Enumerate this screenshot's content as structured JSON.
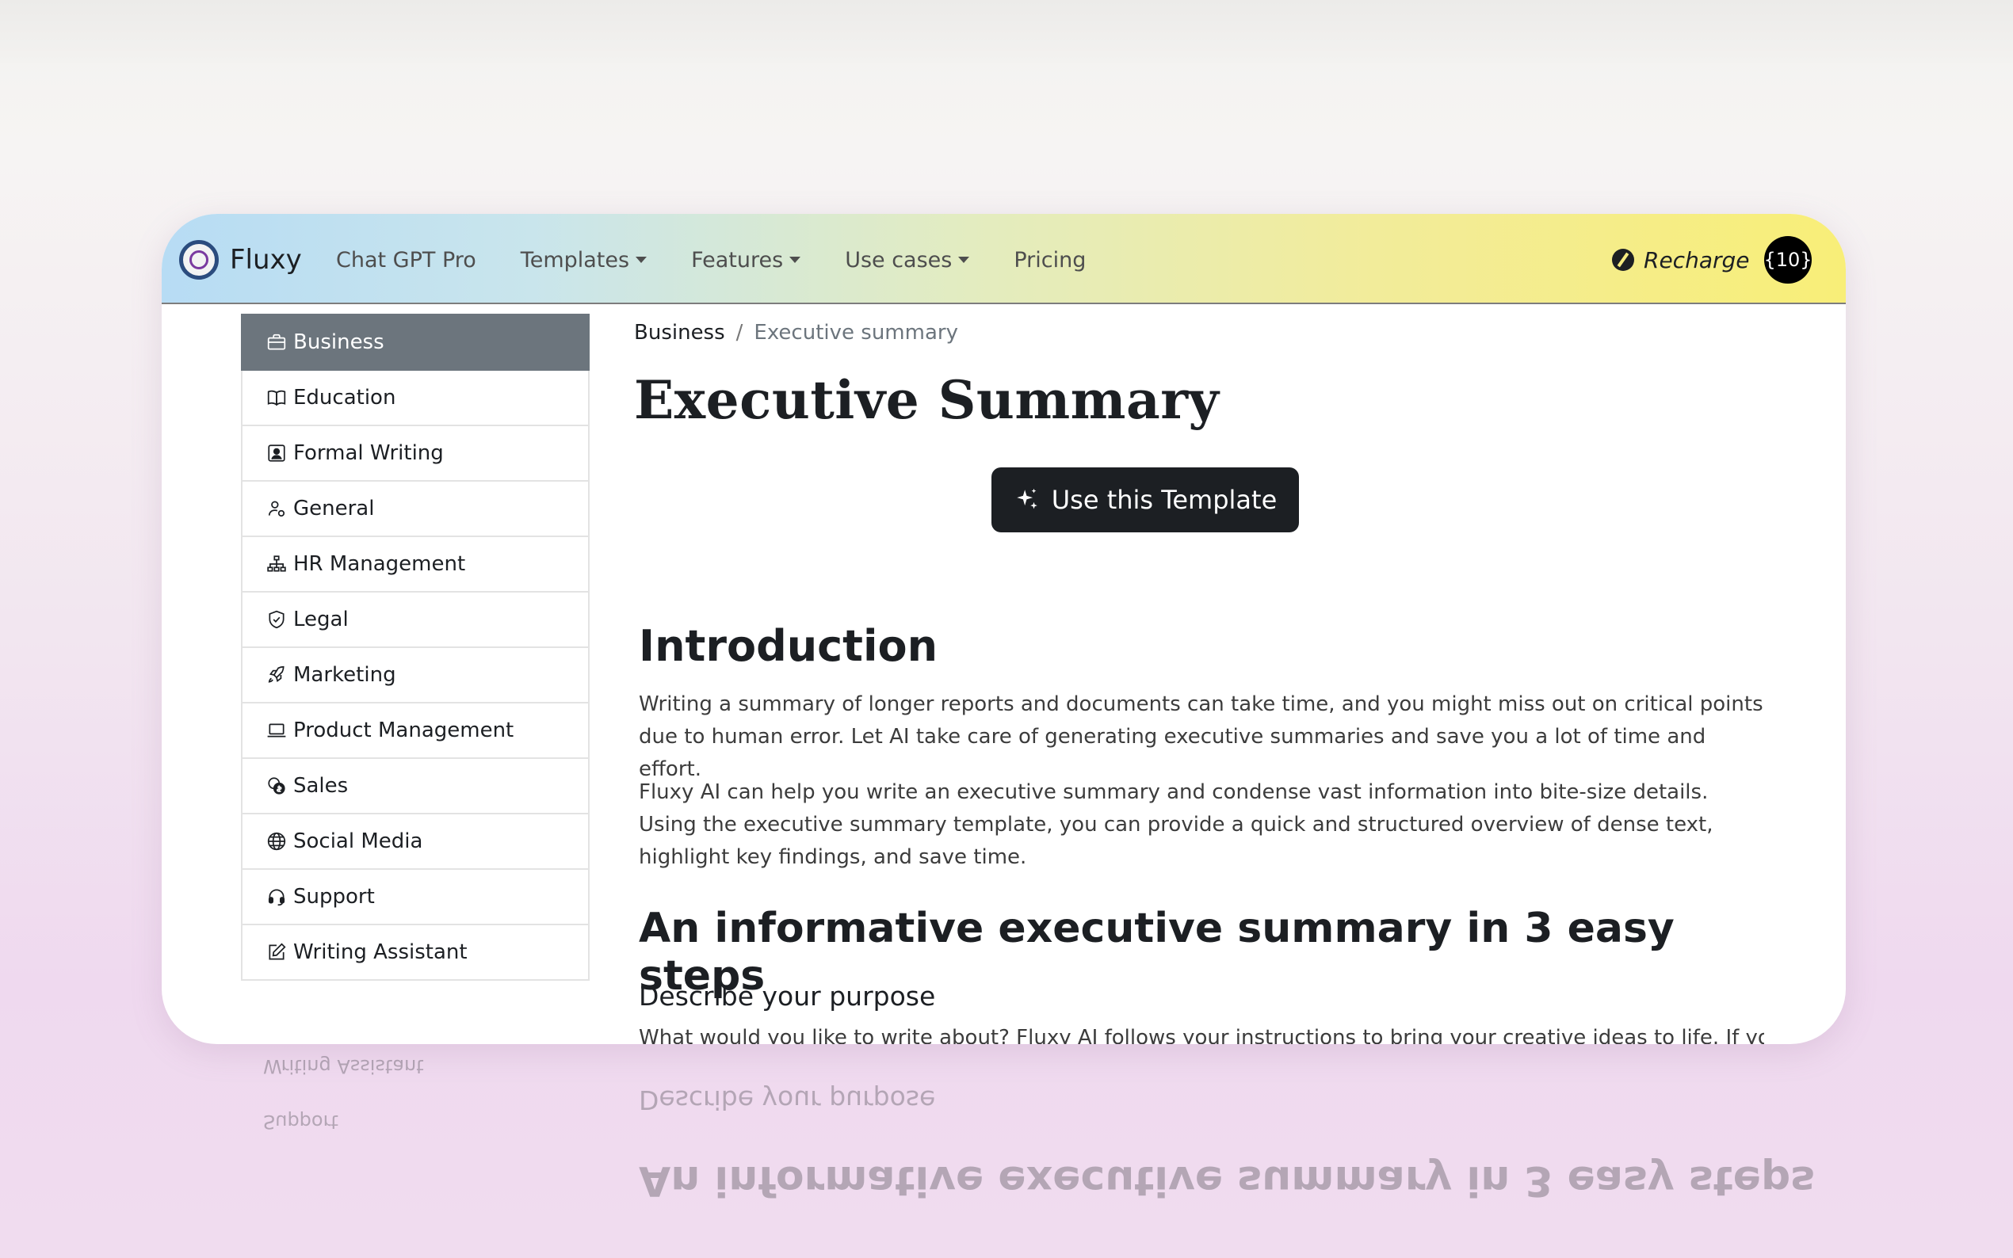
{
  "brand": {
    "name": "Fluxy"
  },
  "nav": {
    "links": [
      {
        "label": "Chat GPT Pro",
        "dropdown": false
      },
      {
        "label": "Templates",
        "dropdown": true
      },
      {
        "label": "Features",
        "dropdown": true
      },
      {
        "label": "Use cases",
        "dropdown": true
      },
      {
        "label": "Pricing",
        "dropdown": false
      }
    ],
    "recharge_label": "Recharge",
    "credits_label": "{10}"
  },
  "sidebar": {
    "items": [
      {
        "label": "Business",
        "icon": "briefcase-icon",
        "active": true
      },
      {
        "label": "Education",
        "icon": "book-icon",
        "active": false
      },
      {
        "label": "Formal Writing",
        "icon": "person-badge-icon",
        "active": false
      },
      {
        "label": "General",
        "icon": "person-gear-icon",
        "active": false
      },
      {
        "label": "HR Management",
        "icon": "org-chart-icon",
        "active": false
      },
      {
        "label": "Legal",
        "icon": "shield-check-icon",
        "active": false
      },
      {
        "label": "Marketing",
        "icon": "rocket-icon",
        "active": false
      },
      {
        "label": "Product Management",
        "icon": "laptop-icon",
        "active": false
      },
      {
        "label": "Sales",
        "icon": "coins-icon",
        "active": false
      },
      {
        "label": "Social Media",
        "icon": "globe-icon",
        "active": false
      },
      {
        "label": "Support",
        "icon": "headset-icon",
        "active": false
      },
      {
        "label": "Writing Assistant",
        "icon": "pencil-square-icon",
        "active": false
      }
    ]
  },
  "breadcrumb": {
    "parent": "Business",
    "separator": "/",
    "current": "Executive summary"
  },
  "page": {
    "title": "Executive Summary",
    "cta_label": "Use this Template",
    "intro_heading": "Introduction",
    "intro_p1": "Writing a summary of longer reports and documents can take time, and you might miss out on critical points due to human error. Let AI take care of generating executive summaries and save you a lot of time and effort.",
    "intro_p2": "Fluxy AI can help you write an executive summary and condense vast information into bite-size details. Using the executive summary template, you can provide a quick and structured overview of dense text, highlight key findings, and save time.",
    "steps_heading": "An informative executive summary in 3 easy steps",
    "step1_heading": "Describe your purpose",
    "step1_text": "What would you like to write about? Fluxy AI follows your instructions to bring your creative ideas to life. If you are"
  },
  "colors": {
    "active_item": "#6c757d",
    "dark": "#1c1f23",
    "nav_gradient_start": "#b7dcf4",
    "nav_gradient_end": "#f8ee78"
  }
}
